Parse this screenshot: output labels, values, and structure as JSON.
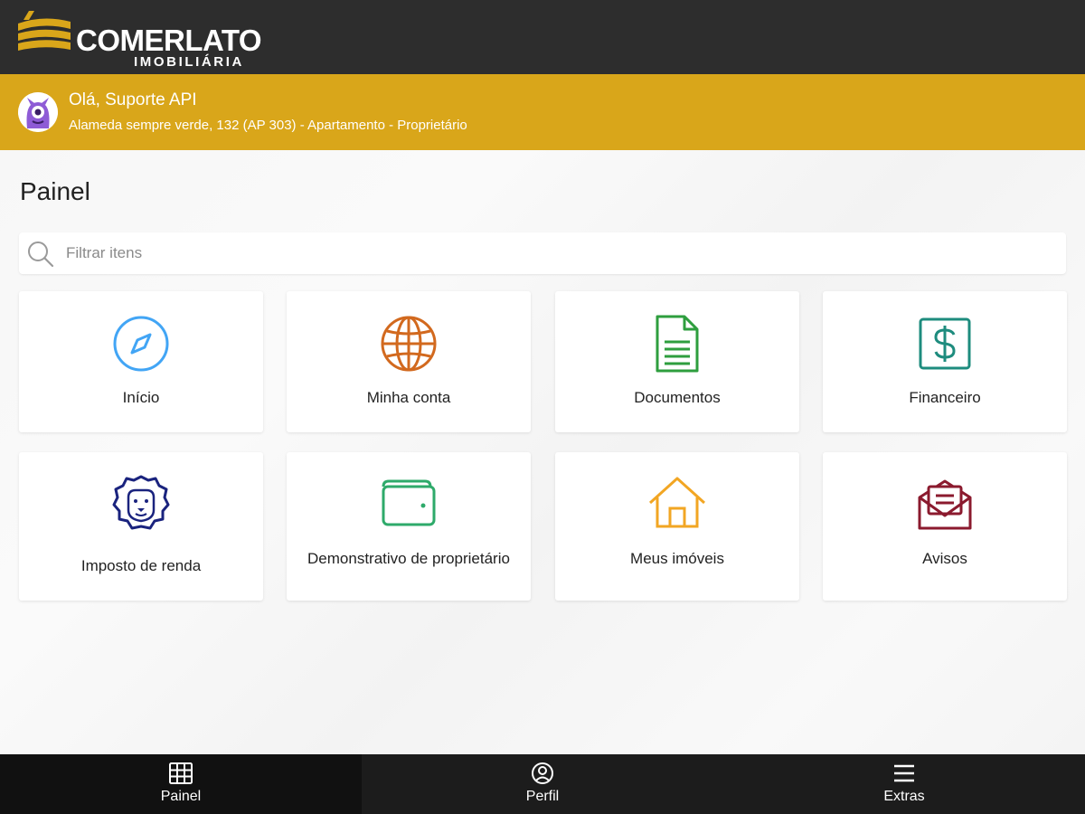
{
  "header": {
    "brand_name": "COMERLATO",
    "brand_sub": "IMOBILIÁRIA",
    "bg_color": "#2d2d2d",
    "brand_color": "#d9a61a"
  },
  "greeting": {
    "title": "Olá, Suporte API",
    "subtitle": "Alameda sempre verde, 132 (AP 303) - Apartamento - Proprietário",
    "bg_color": "#d9a61a"
  },
  "main": {
    "title": "Painel",
    "search": {
      "placeholder": "Filtrar itens",
      "value": "",
      "icon": "search-icon"
    },
    "cards": [
      {
        "label": "Início",
        "icon": "compass-icon",
        "color": "#42a5f5"
      },
      {
        "label": "Minha conta",
        "icon": "globe-icon",
        "color": "#d2691e"
      },
      {
        "label": "Documentos",
        "icon": "document-icon",
        "color": "#2e9e3e"
      },
      {
        "label": "Financeiro",
        "icon": "dollar-icon",
        "color": "#1e8c7e"
      },
      {
        "label": "Imposto de renda",
        "icon": "lion-icon",
        "color": "#1a237e"
      },
      {
        "label": "Demonstrativo de proprietário",
        "icon": "wallet-icon",
        "color": "#2eaa6a"
      },
      {
        "label": "Meus imóveis",
        "icon": "house-icon",
        "color": "#f2a623"
      },
      {
        "label": "Avisos",
        "icon": "mail-icon",
        "color": "#8b1a2e"
      }
    ]
  },
  "bottom_nav": {
    "items": [
      {
        "label": "Painel",
        "icon": "grid-icon",
        "active": true
      },
      {
        "label": "Perfil",
        "icon": "user-circle-icon",
        "active": false
      },
      {
        "label": "Extras",
        "icon": "menu-icon",
        "active": false
      }
    ]
  }
}
